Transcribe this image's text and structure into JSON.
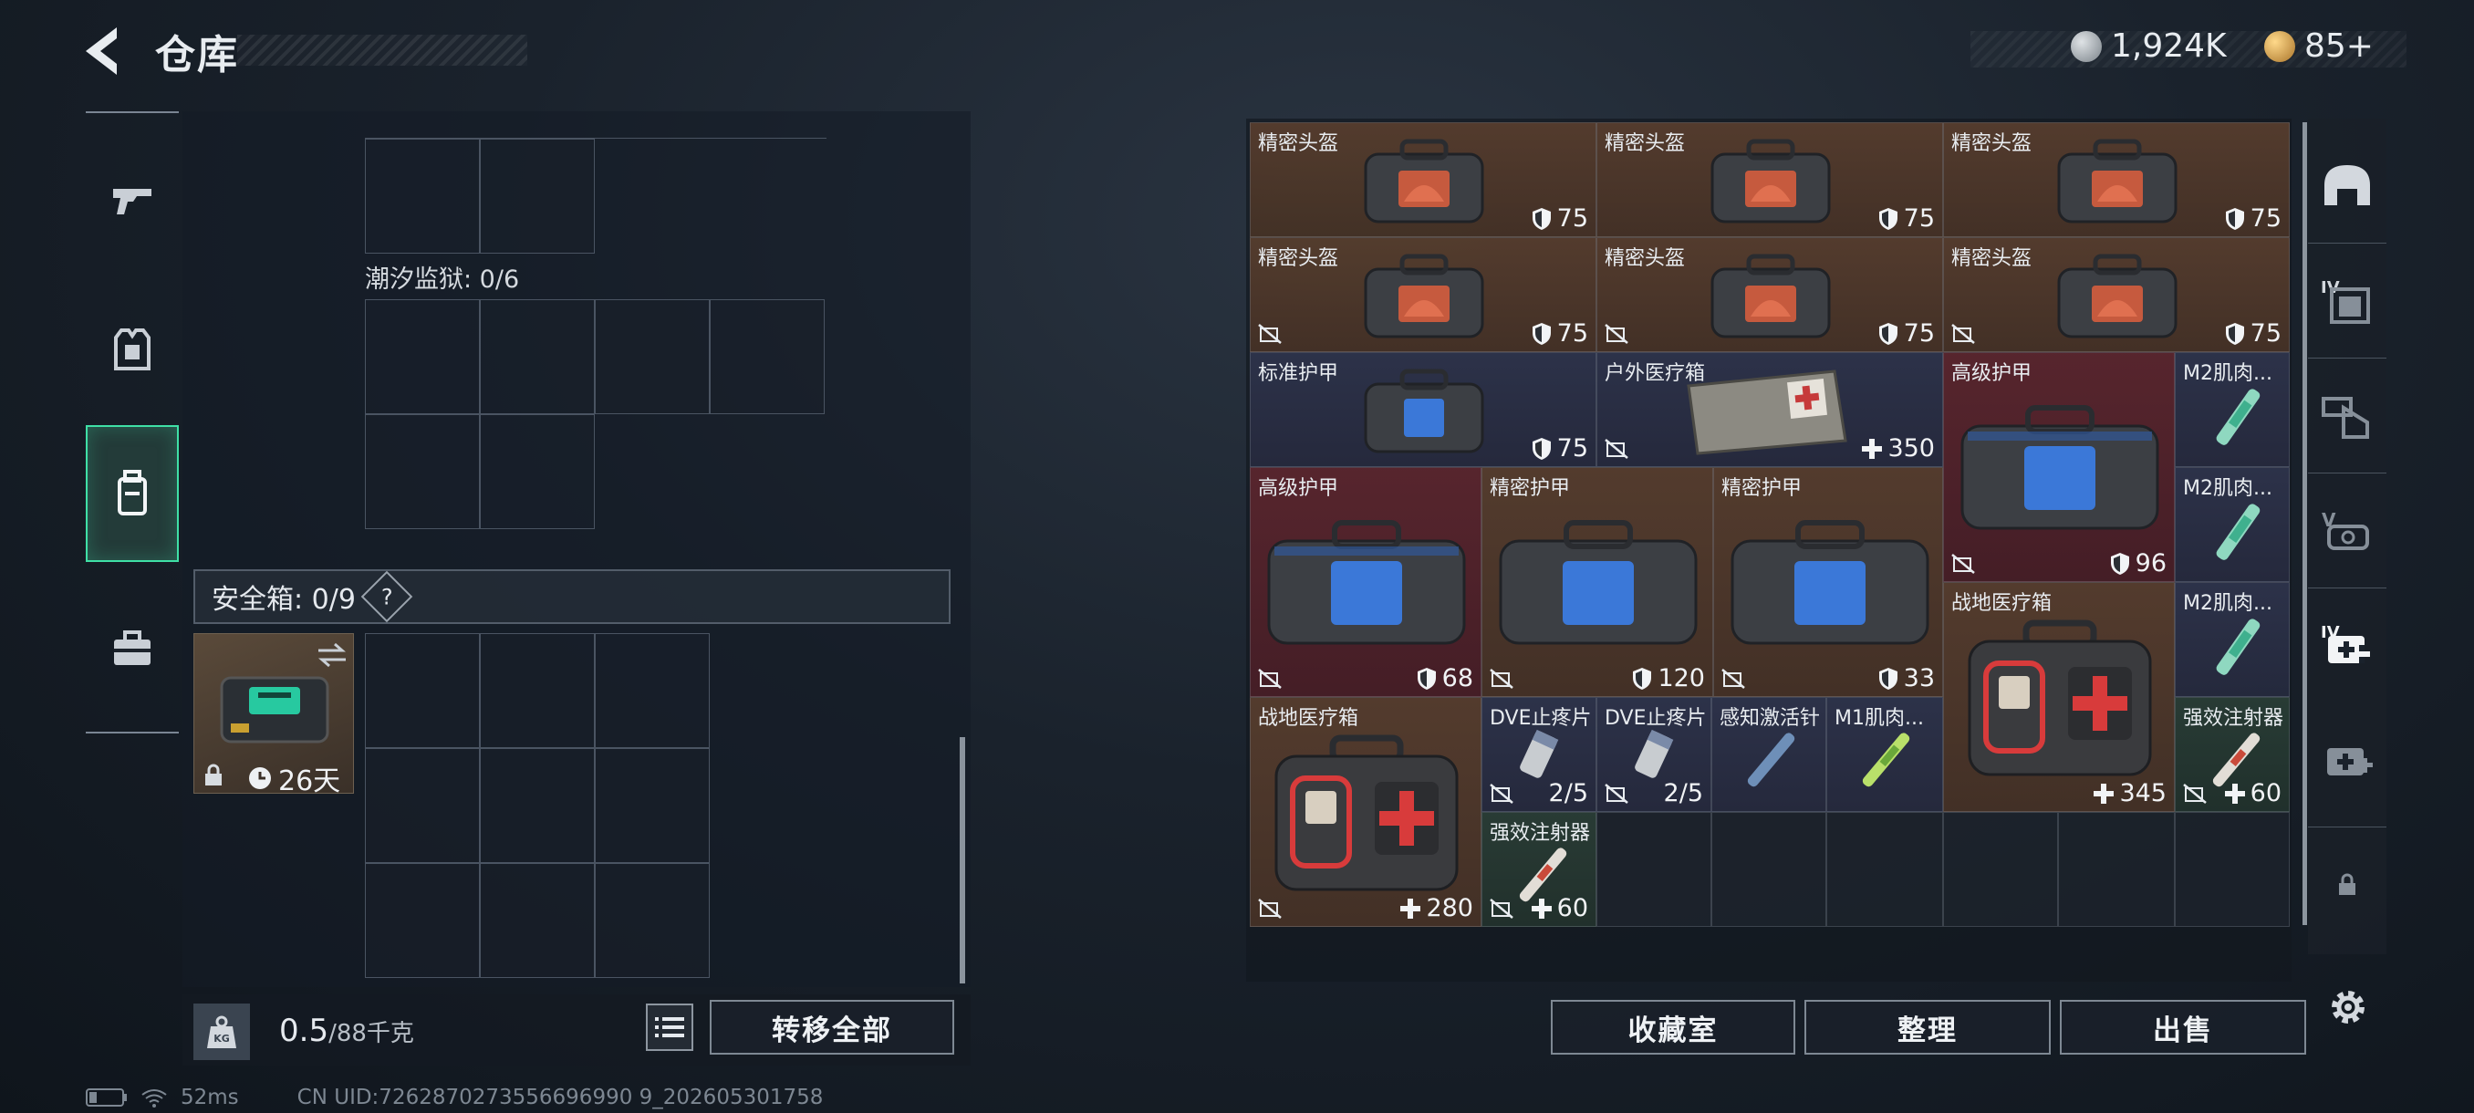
{
  "header": {
    "title": "仓库",
    "silver_amount": "1,924K",
    "gold_amount": "85+"
  },
  "left_tabs": [
    {
      "name": "weapons",
      "icon": "pistol-icon"
    },
    {
      "name": "equipment",
      "icon": "vest-icon"
    },
    {
      "name": "backpack",
      "icon": "backpack-icon",
      "active": true
    },
    {
      "name": "case",
      "icon": "briefcase-icon"
    }
  ],
  "containers": {
    "tidal_prison_label": "潮汐监狱: 0/6",
    "safebox_label": "安全箱: 0/9",
    "safebox_help": "?",
    "safebox_item_timer": "26天"
  },
  "bottom_left": {
    "weight_value": "0.5",
    "weight_capacity": "/88千克",
    "weight_icon_text": "KG",
    "transfer_all": "转移全部"
  },
  "status_bar": {
    "ping": "52ms",
    "uid": "CN UID:7262870273556696990 9_202605301758"
  },
  "storage_items": [
    {
      "name": "精密头盔",
      "value": "75",
      "type": "shield"
    },
    {
      "name": "精密头盔",
      "value": "75",
      "type": "shield"
    },
    {
      "name": "精密头盔",
      "value": "75",
      "type": "shield"
    },
    {
      "name": "精密头盔",
      "value": "75",
      "type": "shield",
      "no_sell": true
    },
    {
      "name": "精密头盔",
      "value": "75",
      "type": "shield",
      "no_sell": true
    },
    {
      "name": "精密头盔",
      "value": "75",
      "type": "shield",
      "no_sell": true
    },
    {
      "name": "标准护甲",
      "value": "75",
      "type": "shield"
    },
    {
      "name": "户外医疗箱",
      "value": "350",
      "type": "heal",
      "no_sell": true
    },
    {
      "name": "高级护甲",
      "value": "96",
      "type": "shield",
      "no_sell": true
    },
    {
      "name": "M2肌肉...",
      "value": "",
      "type": "none"
    },
    {
      "name": "高级护甲",
      "value": "68",
      "type": "shield",
      "no_sell": true
    },
    {
      "name": "精密护甲",
      "value": "120",
      "type": "shield",
      "no_sell": true
    },
    {
      "name": "精密护甲",
      "value": "33",
      "type": "shield",
      "no_sell": true
    },
    {
      "name": "M2肌肉...",
      "value": "",
      "type": "none"
    },
    {
      "name": "战地医疗箱",
      "value": "345",
      "type": "heal"
    },
    {
      "name": "M2肌肉...",
      "value": "",
      "type": "none"
    },
    {
      "name": "战地医疗箱",
      "value": "280",
      "type": "heal",
      "no_sell": true
    },
    {
      "name": "DVE止疼片",
      "value": "2/5",
      "type": "count",
      "no_sell": true
    },
    {
      "name": "DVE止疼片",
      "value": "2/5",
      "type": "count",
      "no_sell": true
    },
    {
      "name": "感知激活针",
      "value": "",
      "type": "none"
    },
    {
      "name": "M1肌肉...",
      "value": "",
      "type": "none"
    },
    {
      "name": "强效注射器",
      "value": "60",
      "type": "heal",
      "no_sell": true
    },
    {
      "name": "强效注射器",
      "value": "60",
      "type": "heal",
      "no_sell": true
    }
  ],
  "bottom_right": {
    "collection_room": "收藏室",
    "organize": "整理",
    "sell": "出售"
  },
  "right_tabs": [
    {
      "icon": "helmet-icon",
      "label": ""
    },
    {
      "icon": "armor-tier-icon",
      "label": "IV"
    },
    {
      "icon": "backpack-tier-icon",
      "label": ""
    },
    {
      "icon": "vest-tier-icon",
      "label": "V"
    },
    {
      "icon": "medkit-tier-icon",
      "label": "IV"
    },
    {
      "icon": "medkit-icon",
      "label": ""
    },
    {
      "icon": "lock-icon",
      "label": ""
    }
  ],
  "colors": {
    "accent_green": "#3fe0a6",
    "item_brown": "#58402e",
    "item_navy": "#2e344c",
    "item_red": "#5c262e",
    "item_green": "#2a3e36"
  }
}
